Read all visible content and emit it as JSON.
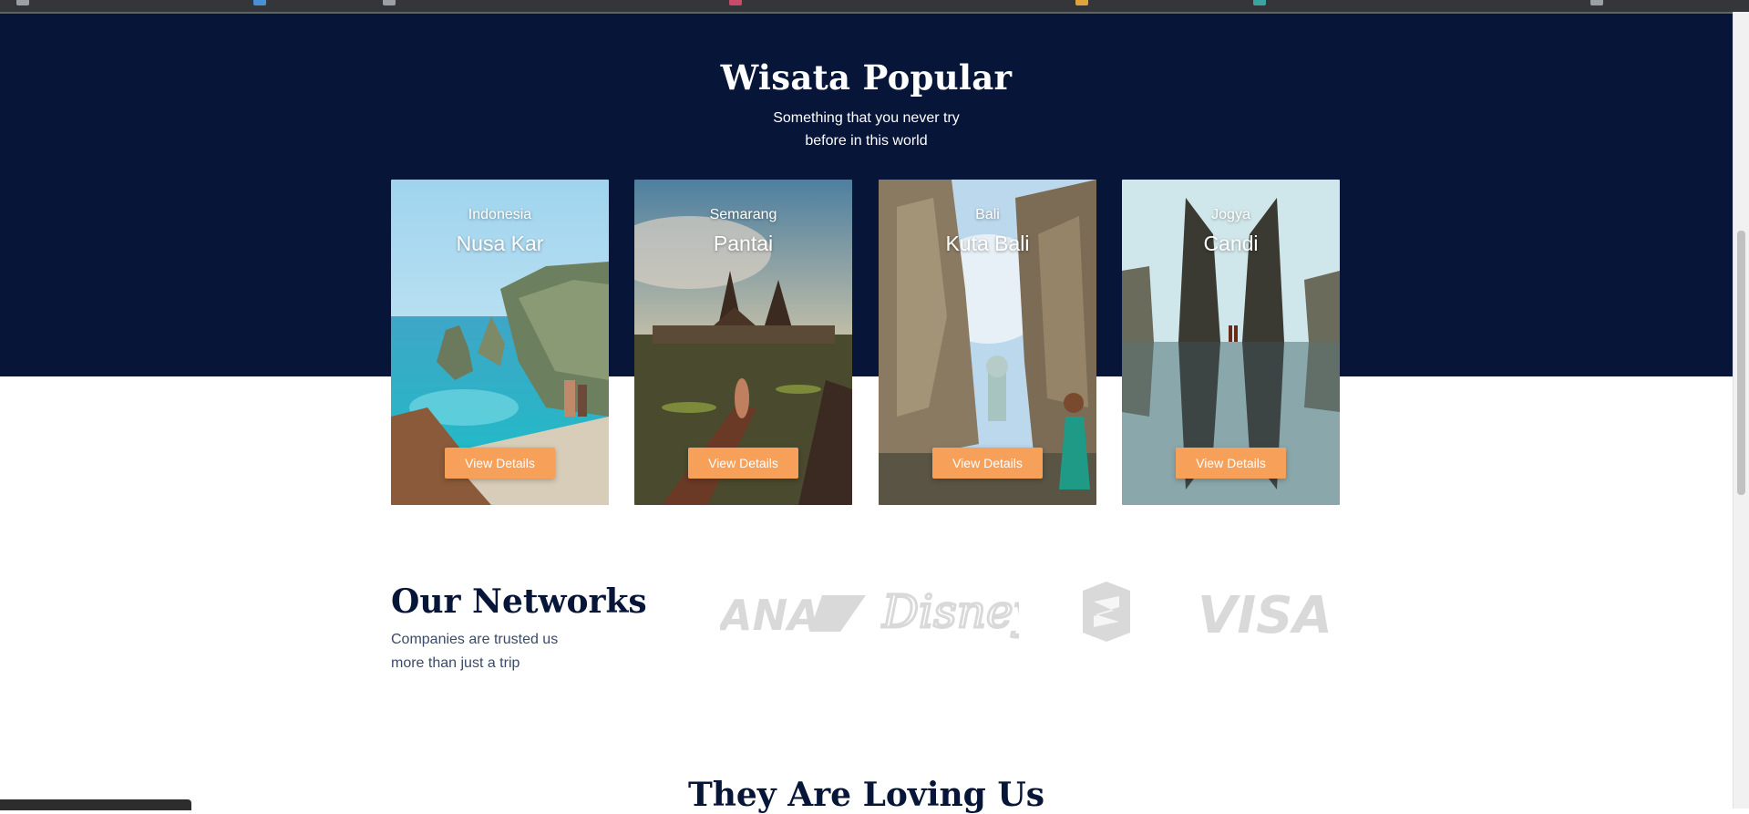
{
  "section": {
    "title": "Wisata Popular",
    "subtitle_line1": "Something that you never try",
    "subtitle_line2": "before in this world"
  },
  "cards": [
    {
      "country": "Indonesia",
      "place": "Nusa Kar",
      "button": "View Details"
    },
    {
      "country": "Semarang",
      "place": "Pantai",
      "button": "View Details"
    },
    {
      "country": "Bali",
      "place": "Kuta Bali",
      "button": "View Details"
    },
    {
      "country": "Jogya",
      "place": "Candi",
      "button": "View Details"
    }
  ],
  "networks": {
    "title": "Our Networks",
    "subtitle_line1": "Companies are trusted us",
    "subtitle_line2": "more than just a trip",
    "logos": [
      {
        "name": "ANA",
        "icon": "ana-logo"
      },
      {
        "name": "Disney",
        "icon": "disney-logo"
      },
      {
        "name": "",
        "icon": "shield-logo"
      },
      {
        "name": "VISA",
        "icon": "visa-logo"
      }
    ]
  },
  "testimonials": {
    "title": "They Are Loving Us"
  },
  "colors": {
    "navy": "#061538",
    "accent": "#f7a05a",
    "logo_gray": "#d9d9d9"
  }
}
